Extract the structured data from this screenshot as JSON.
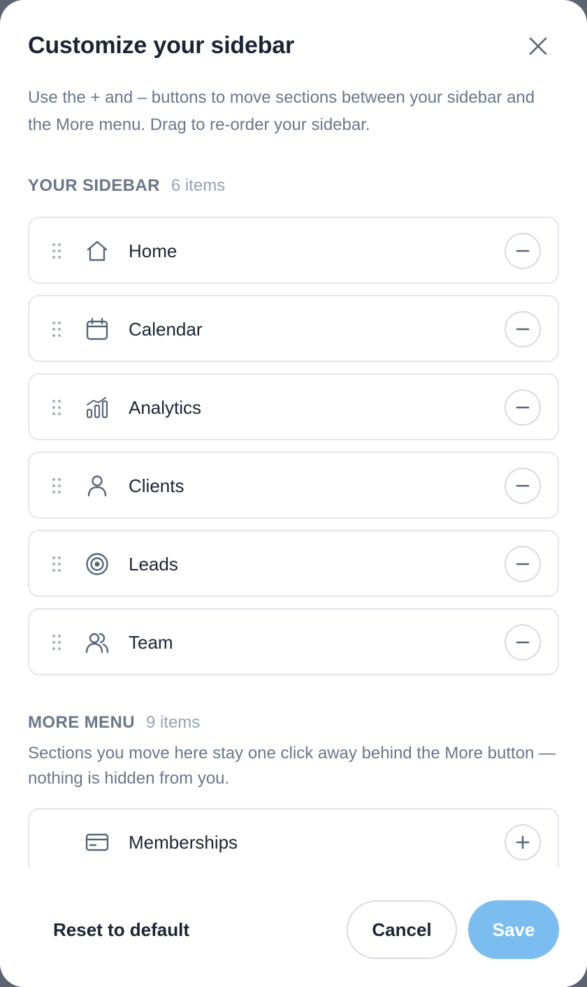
{
  "dialog": {
    "title": "Customize your sidebar",
    "intro": "Use the + and – buttons to move sections between your sidebar and the More menu. Drag to re-order your sidebar."
  },
  "sidebar": {
    "label": "YOUR SIDEBAR",
    "count": "6 items",
    "items": [
      {
        "label": "Home",
        "icon": "home-icon"
      },
      {
        "label": "Calendar",
        "icon": "calendar-icon"
      },
      {
        "label": "Analytics",
        "icon": "analytics-icon"
      },
      {
        "label": "Clients",
        "icon": "user-icon"
      },
      {
        "label": "Leads",
        "icon": "target-icon"
      },
      {
        "label": "Team",
        "icon": "team-icon"
      }
    ]
  },
  "more_menu": {
    "label": "MORE MENU",
    "count": "9 items",
    "description": "Sections you move here stay one click away behind the More button — nothing is hidden from you.",
    "items": [
      {
        "label": "Memberships",
        "icon": "card-icon"
      }
    ]
  },
  "footer": {
    "reset_label": "Reset to default",
    "cancel_label": "Cancel",
    "save_label": "Save"
  },
  "colors": {
    "text_primary": "#1c2433",
    "text_secondary": "#6b7689",
    "icon": "#5a6577",
    "border": "#e3e6ec",
    "save_disabled": "#7bbdee"
  }
}
